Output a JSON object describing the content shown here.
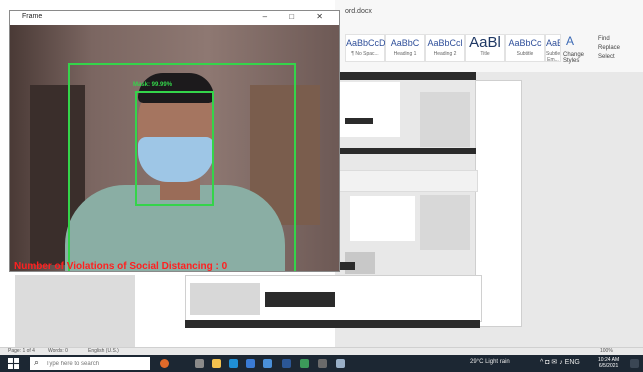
{
  "camera_window": {
    "title": "Frame",
    "controls": "–  □  ✕",
    "face_label": "Mask: 99.99%",
    "social_distance_label": "Number of Violations of Social Distancing : 0"
  },
  "ribbon": {
    "title": "ord.docx",
    "styles": [
      {
        "sample": "AaBbCcDc",
        "caption": "¶ No Spac..."
      },
      {
        "sample": "AaBbC",
        "caption": "Heading 1"
      },
      {
        "sample": "AaBbCcl",
        "caption": "Heading 2"
      },
      {
        "sample": "AaBl",
        "caption": "Title"
      },
      {
        "sample": "AaBbCc",
        "caption": "Subtitle"
      },
      {
        "sample": "AaBbCcDi",
        "caption": "Subtle Em..."
      }
    ],
    "change_styles": "Change Styles",
    "find": "Find",
    "replace": "Replace",
    "select": "Select"
  },
  "statusbar": {
    "page": "Page: 1 of 4",
    "words": "Words: 0",
    "language": "English (U.S.)",
    "zoom": "100%"
  },
  "taskbar": {
    "search_placeholder": "Type here to search",
    "weather": "29°C  Light rain",
    "tray": "^  ◘  ✉  ♪  ENG",
    "time": "10:24 AM",
    "date": "6/5/2021"
  },
  "colors": {
    "detection_box": "#34d44a",
    "violation_text": "#ff2020",
    "taskbar": "#1c2733"
  }
}
